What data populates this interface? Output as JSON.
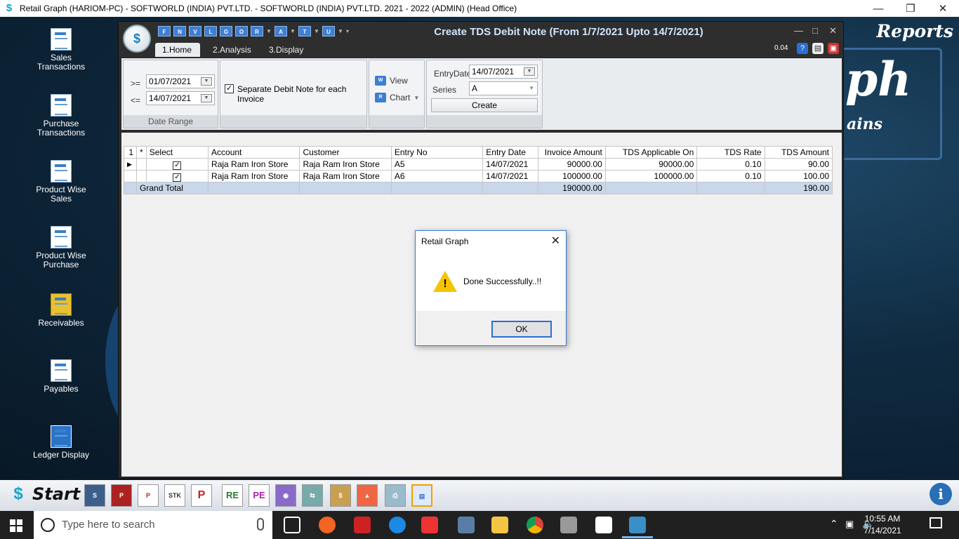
{
  "window": {
    "title": "Retail Graph (HARIOM-PC) - SOFTWORLD (INDIA) PVT.LTD. - SOFTWORLD (INDIA) PVT.LTD.  2021 - 2022 (ADMIN) (Head Office)"
  },
  "brand": {
    "reports": "Reports",
    "ph": "ph",
    "ains": "ains"
  },
  "desktop_icons": [
    {
      "label": "Sales Transactions"
    },
    {
      "label": "Purchase Transactions"
    },
    {
      "label": "Product Wise Sales"
    },
    {
      "label": "Product Wise Purchase"
    },
    {
      "label": "Receivables"
    },
    {
      "label": "Payables"
    },
    {
      "label": "Ledger Display"
    }
  ],
  "app": {
    "title": "Create TDS Debit Note (From 1/7/2021 Upto 14/7/2021)",
    "qat": [
      "F",
      "N",
      "V",
      "L",
      "G",
      "O",
      "R",
      "A",
      "T",
      "U"
    ],
    "tabs": [
      "1.Home",
      "2.Analysis",
      "3.Display"
    ],
    "right_value": "0.04"
  },
  "ribbon": {
    "date_range": {
      "ge_label": ">=",
      "le_label": "<=",
      "from": "01/07/2021",
      "to": "14/07/2021",
      "group_label": "Date Range"
    },
    "separate_note": {
      "label": "Separate Debit Note for each Invoice",
      "checked": true
    },
    "view_label": "View",
    "chart_label": "Chart",
    "entry_date_label": "EntryDate",
    "entry_date": "14/07/2021",
    "series_label": "Series",
    "series": "A",
    "create_label": "Create"
  },
  "grid": {
    "headers": [
      "1",
      "*",
      "Select",
      "Account",
      "Customer",
      "Entry No",
      "Entry Date",
      "Invoice Amount",
      "TDS Applicable On",
      "TDS Rate",
      "TDS Amount"
    ],
    "rows": [
      {
        "account": "Raja Ram Iron Store",
        "customer": "Raja Ram Iron Store",
        "entry_no": "A5",
        "entry_date": "14/07/2021",
        "invoice_amount": "90000.00",
        "tds_on": "90000.00",
        "tds_rate": "0.10",
        "tds_amount": "90.00"
      },
      {
        "account": "Raja Ram Iron Store",
        "customer": "Raja Ram Iron Store",
        "entry_no": "A6",
        "entry_date": "14/07/2021",
        "invoice_amount": "100000.00",
        "tds_on": "100000.00",
        "tds_rate": "0.10",
        "tds_amount": "100.00"
      }
    ],
    "total": {
      "label": "Grand Total",
      "invoice_amount": "190000.00",
      "tds_amount": "190.00"
    }
  },
  "dialog": {
    "title": "Retail Graph",
    "message": "Done Successfully..!!",
    "ok": "OK"
  },
  "app_toolbar": {
    "start": "Start"
  },
  "taskbar": {
    "search_placeholder": "Type here to search",
    "time": "10:55 AM",
    "date": "7/14/2021"
  },
  "colors": {
    "accent": "#3a7bd5",
    "total_row": "#c8d7ea",
    "warning": "#f5c400"
  }
}
